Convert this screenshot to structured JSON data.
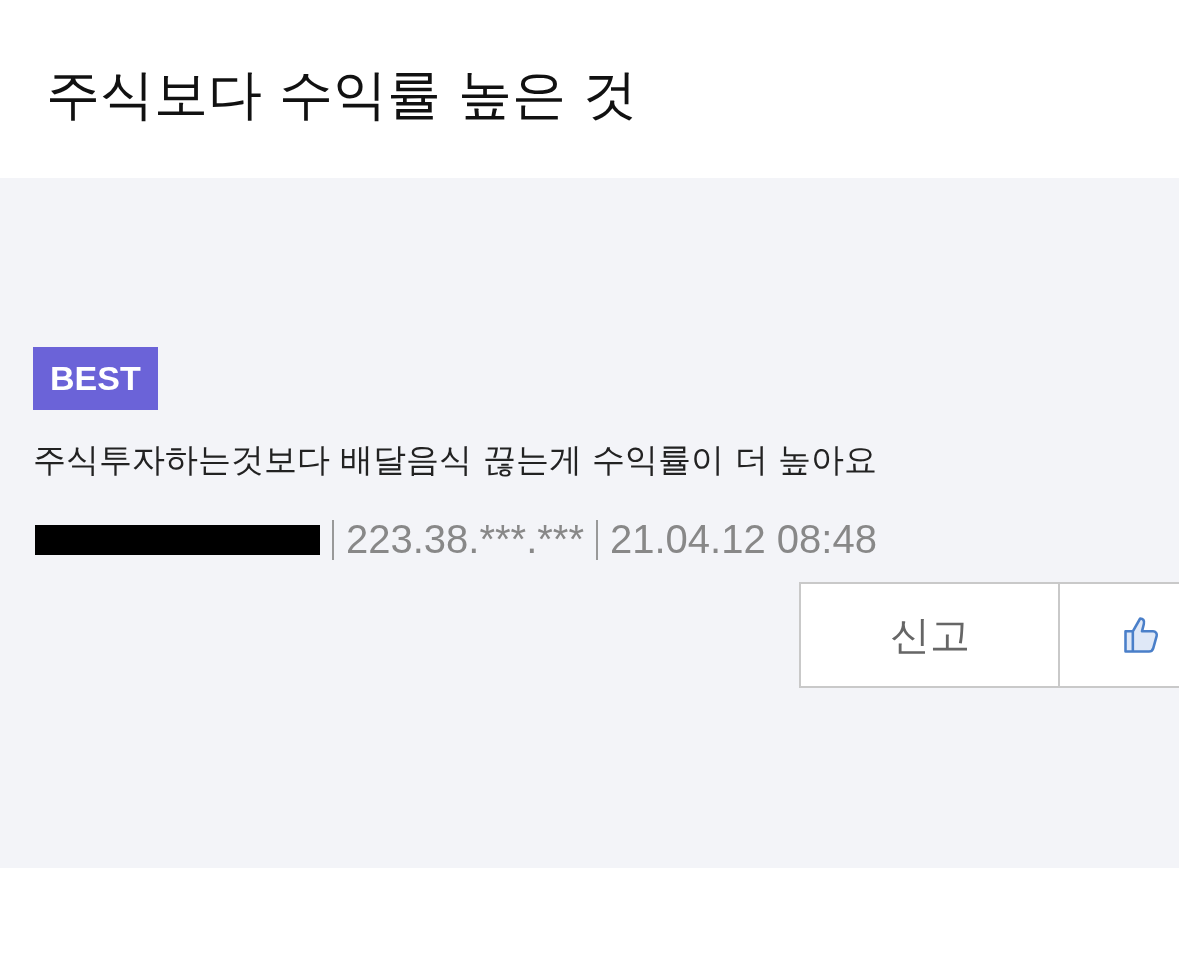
{
  "title": "주식보다 수익률 높은 것",
  "comment": {
    "badge": "BEST",
    "text": "주식투자하는것보다 배달음식 끊는게 수익률이 더 높아요",
    "author_redacted": true,
    "ip": "223.38.***.***",
    "date": "21.04.12 08:48"
  },
  "buttons": [
    {
      "kind": "text",
      "label": "신고"
    },
    {
      "kind": "like"
    }
  ]
}
